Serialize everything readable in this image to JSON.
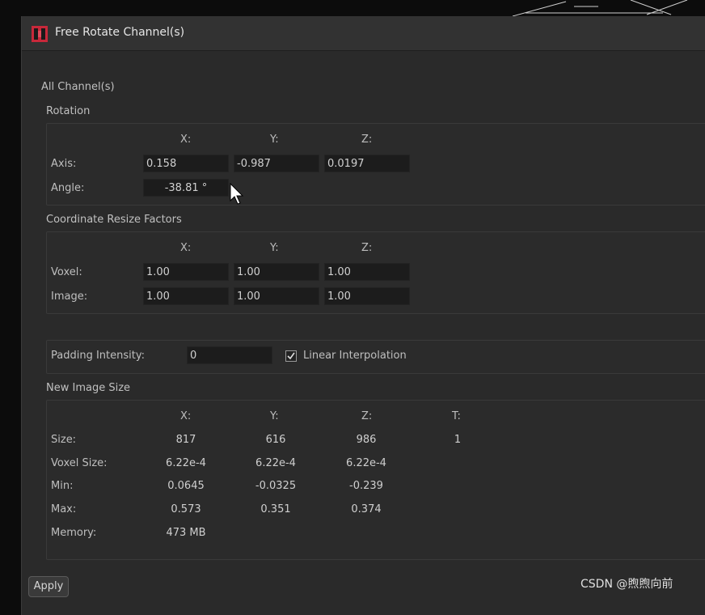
{
  "window": {
    "title": "Free Rotate Channel(s)"
  },
  "all_channels_label": "All Channel(s)",
  "rotation": {
    "title": "Rotation",
    "headers": [
      "X:",
      "Y:",
      "Z:"
    ],
    "axis_label": "Axis:",
    "axis_values": [
      "0.158",
      "-0.987",
      "0.0197"
    ],
    "angle_label": "Angle:",
    "angle_value": "-38.81 °"
  },
  "resize": {
    "title": "Coordinate Resize Factors",
    "headers": [
      "X:",
      "Y:",
      "Z:"
    ],
    "voxel_label": "Voxel:",
    "voxel_values": [
      "1.00",
      "1.00",
      "1.00"
    ],
    "image_label": "Image:",
    "image_values": [
      "1.00",
      "1.00",
      "1.00"
    ]
  },
  "padding": {
    "label": "Padding Intensity:",
    "value": "0",
    "linear_interpolation_label": "Linear Interpolation",
    "linear_interpolation_checked": true
  },
  "new_image_size": {
    "title": "New Image Size",
    "headers": [
      "X:",
      "Y:",
      "Z:",
      "T:"
    ],
    "rows": [
      {
        "label": "Size:",
        "values": [
          "817",
          "616",
          "986",
          "1"
        ]
      },
      {
        "label": "Voxel Size:",
        "values": [
          "6.22e-4",
          "6.22e-4",
          "6.22e-4"
        ]
      },
      {
        "label": "Min:",
        "values": [
          "0.0645",
          "-0.0325",
          "-0.239"
        ]
      },
      {
        "label": "Max:",
        "values": [
          "0.573",
          "0.351",
          "0.374"
        ]
      },
      {
        "label": "Memory:",
        "values": [
          "473 MB"
        ]
      }
    ]
  },
  "apply_label": "Apply",
  "watermark": "CSDN @煦煦向前",
  "colors": {
    "dialog_bg": "#2a2a2a",
    "field_bg": "#1c1c1c",
    "icon_red": "#c8283a"
  },
  "icons": {
    "app": "app-logo-icon",
    "cursor": "mouse-pointer-icon",
    "check": "checkmark-icon"
  }
}
